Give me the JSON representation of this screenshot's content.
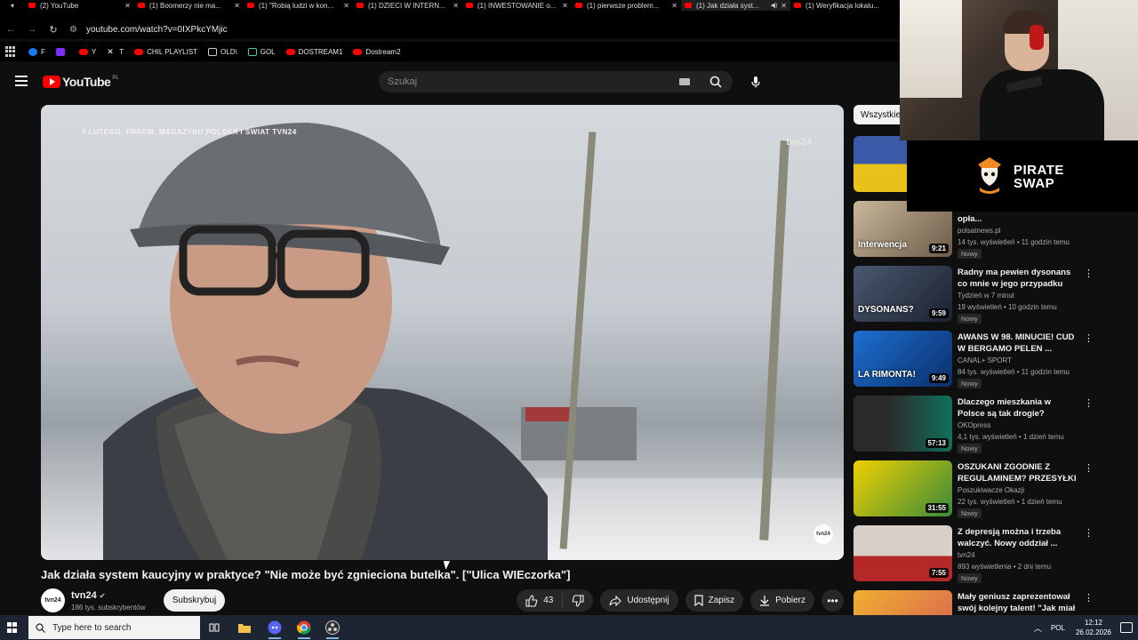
{
  "browser": {
    "tabs": [
      {
        "label": "(2) YouTube",
        "active": false
      },
      {
        "label": "(1) Boomerzy nie ma...",
        "active": false
      },
      {
        "label": "(1) \"Robią ludzi w kon...",
        "active": false
      },
      {
        "label": "(1) DZIECI W INTERN...",
        "active": false
      },
      {
        "label": "(1) INWESTOWANIE o...",
        "active": false
      },
      {
        "label": "(1) pierwsze problem...",
        "active": false
      },
      {
        "label": "(1) Jak działa syst...",
        "active": true
      },
      {
        "label": "(1) Weryfikacja lokalu...",
        "active": false
      }
    ],
    "url": "youtube.com/watch?v=0IXPkcYMjic",
    "bookmarks": [
      {
        "label": "F",
        "icon": "facebook-icon"
      },
      {
        "label": "",
        "icon": "twitch-icon"
      },
      {
        "label": "Y",
        "icon": "youtube-icon"
      },
      {
        "label": "T",
        "icon": "x-icon"
      },
      {
        "label": "CHIL PLAYLIST",
        "icon": "youtube-icon"
      },
      {
        "label": "OLD\\",
        "icon": "folder-icon"
      },
      {
        "label": "GOL",
        "icon": "gol-icon"
      },
      {
        "label": "DOSTREAM1",
        "icon": "youtube-icon"
      },
      {
        "label": "Dostream2",
        "icon": "youtube-icon"
      }
    ]
  },
  "youtube": {
    "logo_text": "YouTube",
    "country": "PL",
    "search_placeholder": "Szukaj"
  },
  "player": {
    "overlay_caption": "5 LUTEGO, FRAGM. MAGAZYNU POLSKA I ŚWIAT TVN24",
    "watermark": "tvn24",
    "corner_badge": "tvn24"
  },
  "video": {
    "title": "Jak działa system kaucyjny w praktyce? \"Nie może być zgnieciona butelka\". [\"Ulica WIEczorka\"]",
    "channel_name": "tvn24",
    "channel_avatar": "tvn24",
    "subscribers": "186 tys. subskrybentów",
    "subscribe_label": "Subskrybuj",
    "likes": "43",
    "share_label": "Udostępnij",
    "save_label": "Zapisz",
    "download_label": "Pobierz"
  },
  "sidebar": {
    "chip_label": "Wszystkie",
    "items": [
      {
        "title": "",
        "channel": "",
        "meta": "",
        "badge": "",
        "duration": "",
        "thumb_text": "",
        "thumb_colors": [
          "#3a5aa8",
          "#e8c21a"
        ]
      },
      {
        "title": "kolosalne rachunki. \"Albo opła...",
        "channel": "polsatnews.pl",
        "meta": "14 tys. wyświetleń • 11 godzin temu",
        "badge": "Nowy",
        "duration": "9:21",
        "thumb_text": "Interwencja",
        "thumb_colors": [
          "#c9b79a",
          "#6d5a48"
        ]
      },
      {
        "title": "Radny ma pewien dysonans co mnie w jego przypadku nie ...",
        "channel": "Tydzień w 7 minut",
        "meta": "19 wyświetleń • 10 godzin temu",
        "badge": "Nowy",
        "duration": "9:59",
        "thumb_text": "DYSONANS?",
        "thumb_colors": [
          "#4a5870",
          "#1b2230"
        ]
      },
      {
        "title": "AWANS W 98. MINUCIE! CUD W BERGAMO PELEN ...",
        "channel": "CANAL+ SPORT",
        "meta": "84 tys. wyświetleń • 11 godzin temu",
        "badge": "Nowy",
        "duration": "9:49",
        "thumb_text": "LA RIMONTA!",
        "thumb_colors": [
          "#1d6fd1",
          "#0b2f6a"
        ]
      },
      {
        "title": "Dlaczego mieszkania w Polsce są tak drogie? #DlaczegoTak",
        "channel": "OKOpress",
        "meta": "4,1 tys. wyświetleń • 1 dzień temu",
        "badge": "Nowy",
        "duration": "57:13",
        "thumb_text": "",
        "thumb_colors": [
          "#2a2a2a",
          "#11705a"
        ]
      },
      {
        "title": "OSZUKANI ZGODNIE Z REGULAMINEM? PRZESYŁKI ...",
        "channel": "Poszukiwacze Okazji",
        "meta": "22 tys. wyświetleń • 1 dzień temu",
        "badge": "Nowy",
        "duration": "31:55",
        "thumb_text": "",
        "thumb_colors": [
          "#f0d000",
          "#3a8a3a"
        ]
      },
      {
        "title": "Z depresją można i trzeba walczyć. Nowy oddział ...",
        "channel": "tvn24",
        "meta": "893 wyświetlenia • 2 dni temu",
        "badge": "Nowy",
        "duration": "7:55",
        "thumb_text": "",
        "thumb_colors": [
          "#d8d0c8",
          "#b42828"
        ]
      },
      {
        "title": "Mały geniusz zaprezentował swój kolejny talent! \"Jak miał ...",
        "channel": "",
        "meta": "",
        "badge": "",
        "duration": "",
        "thumb_text": "",
        "thumb_colors": [
          "#f0b030",
          "#d86050"
        ]
      }
    ]
  },
  "sponsor": {
    "name_line1": "PIRATE",
    "name_line2": "SWAP"
  },
  "taskbar": {
    "search_placeholder": "Type here to search",
    "language": "POL",
    "time": "12:12",
    "date": "26.02.2026"
  },
  "colors": {
    "youtube_red": "#ff0000",
    "page_bg": "#0f0f0f",
    "pill_bg": "#272727"
  }
}
